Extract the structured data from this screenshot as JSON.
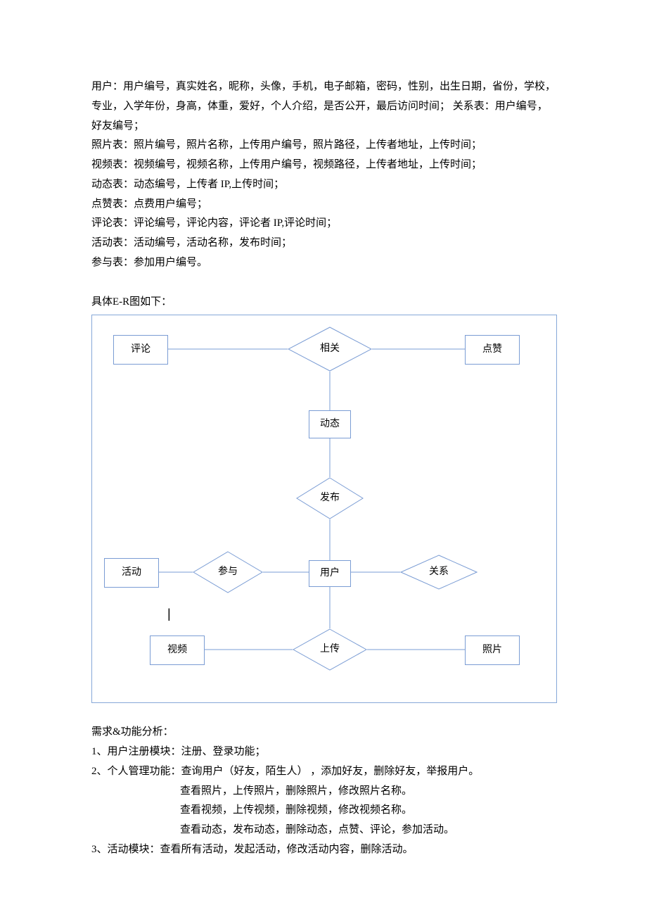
{
  "text": {
    "p1": "用户：用户编号，真实姓名，昵称，头像，手机，电子邮箱，密码，性别，出生日期，省份，学校，专业，入学年份，身高，体重，爱好，个人介绍，是否公开，最后访问时间；  关系表：用户编号，好友编号；",
    "p2": "照片表：照片编号，照片名称，上传用户编号，照片路径，上传者地址，上传时间；",
    "p3": "视频表：视频编号，视频名称，上传用户编号，视频路径，上传者地址，上传时间；",
    "p4": "动态表：动态编号，上传者 IP,上传时间；",
    "p5": "点赞表：点费用户编号；",
    "p6": "评论表：评论编号，评论内容，评论者 IP,评论时间；",
    "p7": "活动表：活动编号，活动名称，发布时间；",
    "p8": "参与表：参加用户编号。",
    "diagramTitle": "具体E-R图如下：",
    "reqTitle": "需求&功能分析：",
    "r1": "1、用户注册模块：注册、登录功能；",
    "r2": "2、个人管理功能：查询用户（好友，陌生人） ，添加好友，删除好友，举报用户。",
    "r2a": "查看照片，上传照片，删除照片，修改照片名称。",
    "r2b": "查看视频，上传视频，删除视频，修改视频名称。",
    "r2c": "查看动态，发布动态，删除动态，点赞、评论，参加活动。",
    "r3": "3、活动模块：查看所有活动，发起活动，修改活动内容，删除活动。"
  },
  "diagram": {
    "entities": {
      "comment": "评论",
      "like": "点赞",
      "dynamic": "动态",
      "user": "用户",
      "activity": "活动",
      "video": "视频",
      "photo": "照片"
    },
    "relations": {
      "related": "相关",
      "publish": "发布",
      "participate": "参与",
      "relationship": "关系",
      "upload": "上传"
    }
  }
}
